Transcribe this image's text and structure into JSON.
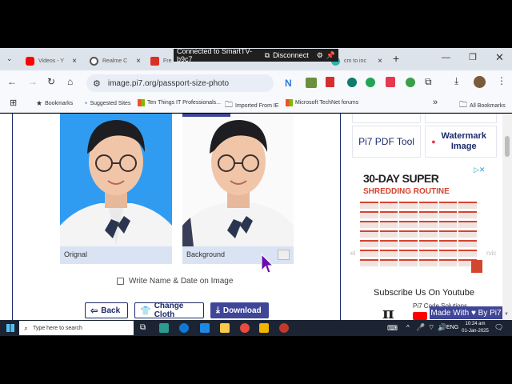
{
  "tabs": [
    {
      "label": "Videos - Y",
      "favicon_color": "#ff0000"
    },
    {
      "label": "Realme C",
      "favicon_color": "#555555"
    },
    {
      "label": "Fre",
      "favicon_color": "#d93025"
    },
    {
      "label": "cm to inc",
      "favicon_color": "#1a73e8"
    }
  ],
  "cast": {
    "status": "Connected to SmartTV-b9c7",
    "disconnect": "Disconnect"
  },
  "address": {
    "url": "image.pi7.org/passport-size-photo"
  },
  "bookmarks": {
    "label": "Bookmarks",
    "items": [
      "Suggested Sites",
      "Ten Things IT Professionals...",
      "Imported From IE",
      "Microsoft TechNet forums"
    ],
    "all": "All Bookmarks"
  },
  "main": {
    "original_label": "Orignal",
    "background_label": "Background",
    "write_name_label": "Write Name & Date on Image",
    "back_label": "Back",
    "change_cloth_label": "Change Cloth",
    "download_label": "Download"
  },
  "sidebar": {
    "pdf_tool": "Pi7 PDF Tool",
    "watermark": "Watermark Image",
    "ad_title": "30-DAY SUPER",
    "ad_subtitle": "SHREDDING ROUTINE",
    "subscribe": "Subscribe Us On Youtube",
    "channel": "Pi7 Code Solutions",
    "made_with": "Made With ♥ By  Pi7",
    "cut_left": "el",
    "cut_right": "rvic"
  },
  "taskbar": {
    "search_placeholder": "Type here to search",
    "lang": "ENG",
    "time": "10:24 am",
    "date": "01-Jan-2025"
  },
  "colors": {
    "accent": "#3f4597",
    "border": "#1d2a6b",
    "photo_bg_blue": "#2f9cf2"
  }
}
